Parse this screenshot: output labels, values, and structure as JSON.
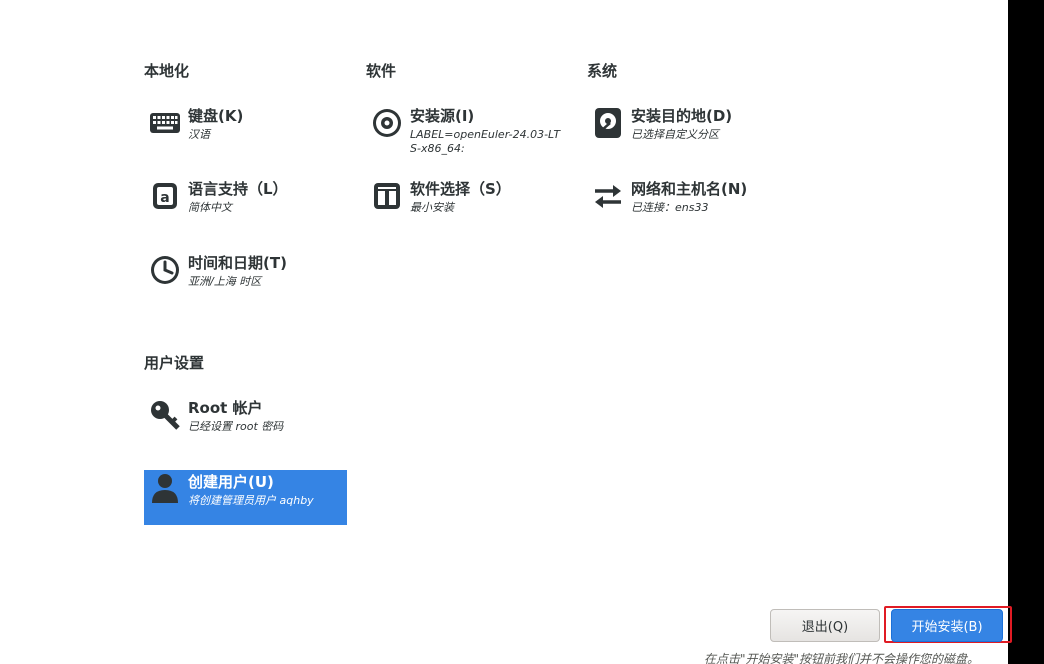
{
  "sections": {
    "localization": "本地化",
    "software": "软件",
    "system": "系统",
    "user_settings": "用户设置"
  },
  "spokes": {
    "keyboard": {
      "name": "键盘(K)",
      "status": "汉语",
      "icon": "keyboard-icon"
    },
    "language": {
      "name": "语言支持（L）",
      "status": "简体中文",
      "icon": "language-icon"
    },
    "time": {
      "name": "时间和日期(T)",
      "status": "亚洲/上海 时区",
      "icon": "clock-icon"
    },
    "source": {
      "name": "安装源(I)",
      "status": "LABEL=openEuler-24.03-LTS-x86_64:",
      "icon": "disc-icon"
    },
    "software_selection": {
      "name": "软件选择（S）",
      "status": "最小安装",
      "icon": "package-icon"
    },
    "destination": {
      "name": "安装目的地(D)",
      "status": "已选择自定义分区",
      "icon": "harddisk-icon"
    },
    "network": {
      "name": "网络和主机名(N)",
      "status": "已连接：ens33",
      "icon": "network-arrows-icon"
    },
    "root": {
      "name": "Root 帐户",
      "status": "已经设置 root 密码",
      "icon": "key-icon"
    },
    "user": {
      "name": "创建用户(U)",
      "status": "将创建管理员用户 aqhby",
      "icon": "user-icon"
    }
  },
  "buttons": {
    "quit": "退出(Q)",
    "begin": "开始安装(B)"
  },
  "footnote": "在点击\"开始安装\"按钮前我们并不会操作您的磁盘。",
  "colors": {
    "accent": "#3584e4",
    "highlight_border": "#e01b24",
    "text": "#2e3436"
  }
}
